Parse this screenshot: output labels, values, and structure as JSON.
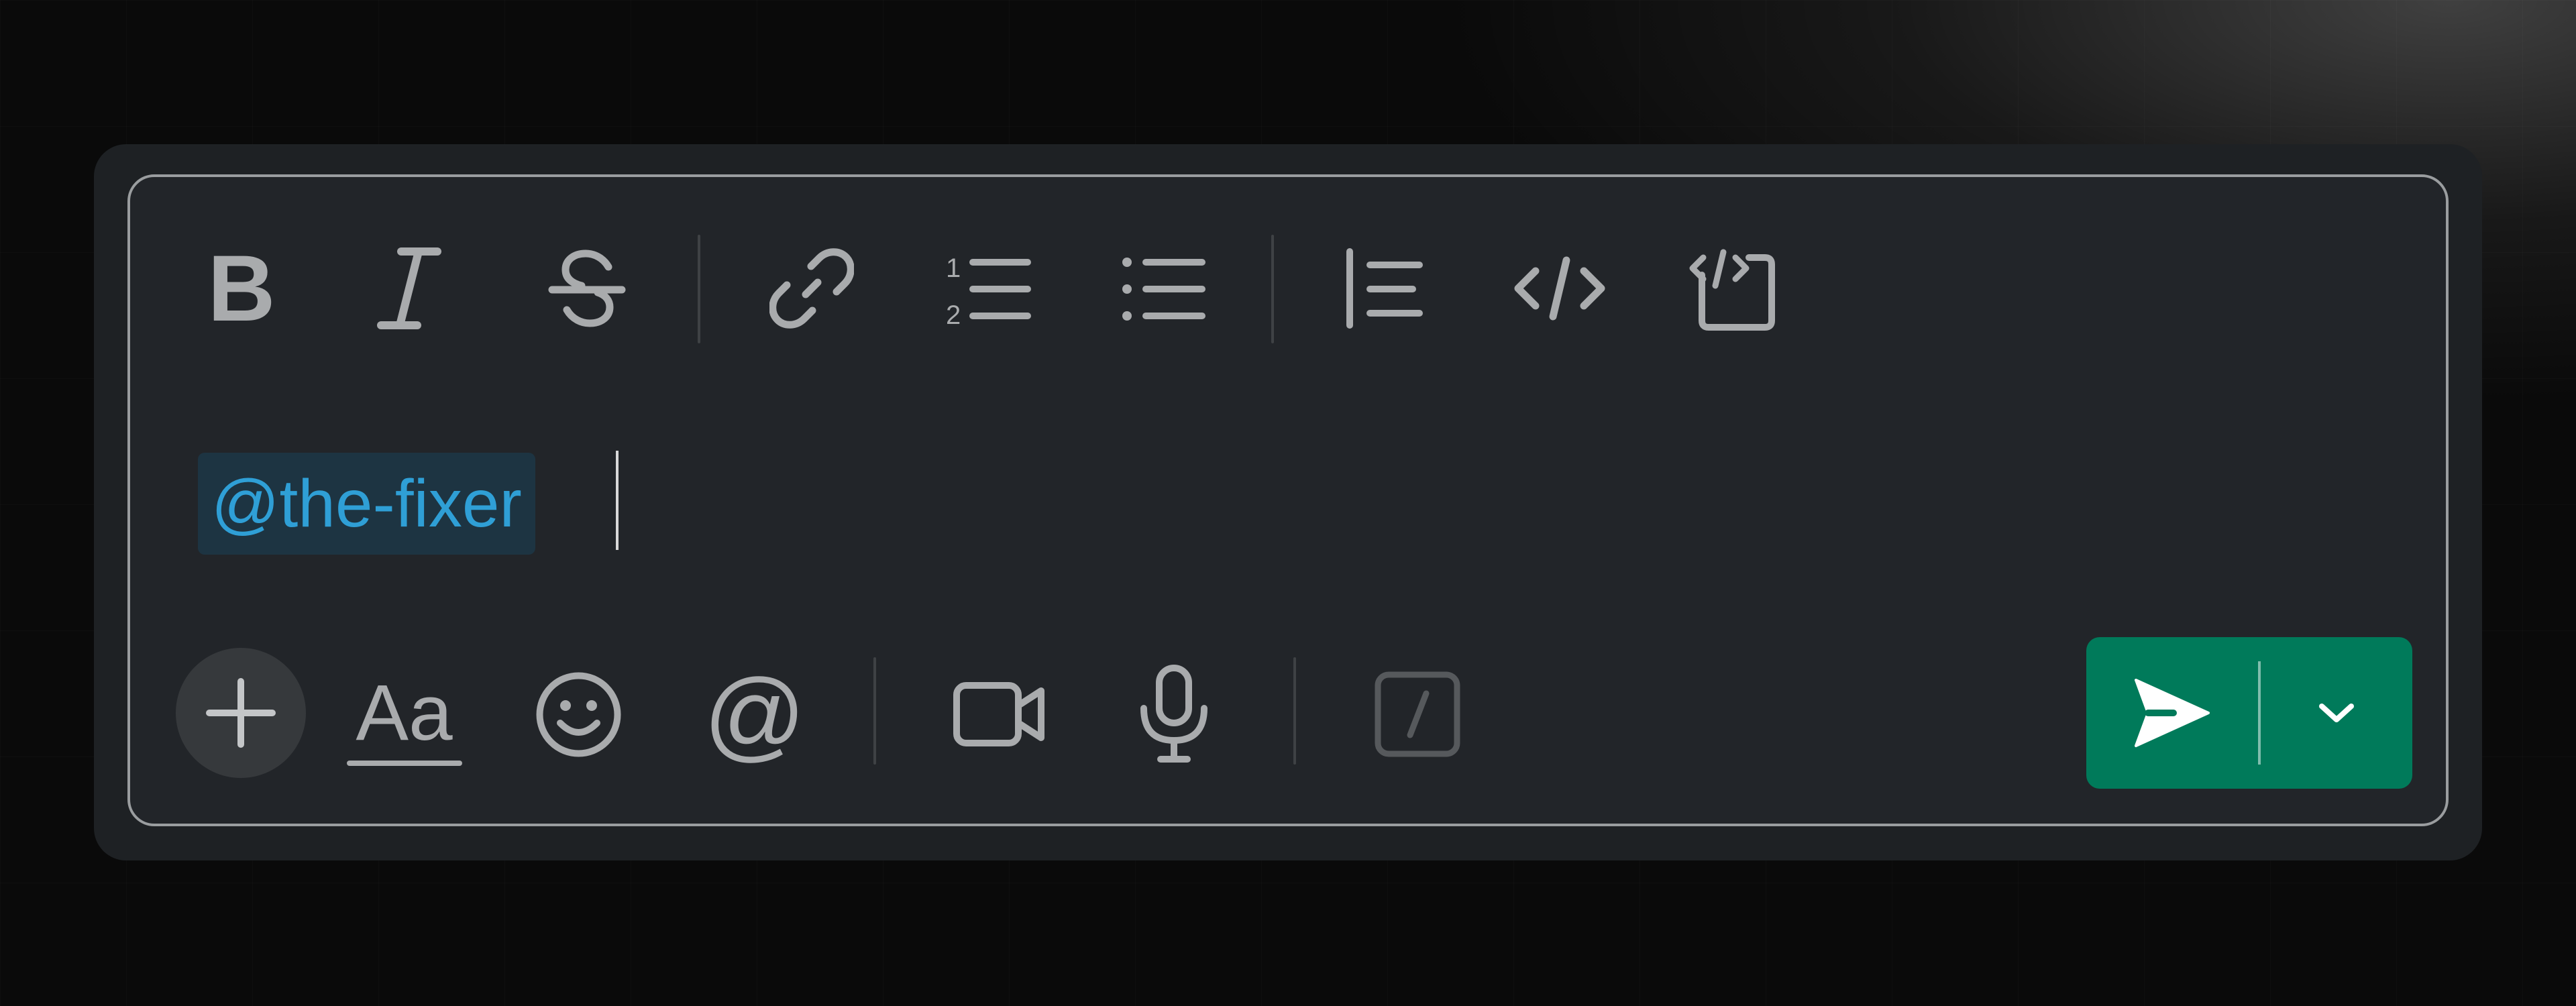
{
  "toolbar": {
    "bold_label": "B",
    "italic_label": "I",
    "strike_label": "S",
    "link_icon": "link-icon",
    "ordered_list_icon": "ordered-list-icon",
    "ordered_list_numbers": [
      "1",
      "2"
    ],
    "bullet_list_icon": "bullet-list-icon",
    "quote_icon": "blockquote-icon",
    "code_icon": "code-icon",
    "code_block_icon": "code-block-icon"
  },
  "message": {
    "mention": "@the-fixer"
  },
  "actions": {
    "attach_icon": "plus-icon",
    "format_label": "Aa",
    "emoji_icon": "smiley-icon",
    "mention_label": "@",
    "video_icon": "video-camera-icon",
    "audio_icon": "microphone-icon",
    "shortcut_label": "/",
    "send_icon": "paper-plane-icon",
    "send_options_icon": "chevron-down-icon"
  },
  "colors": {
    "send_button": "#007a5a",
    "mention_text": "#2f9fd6",
    "mention_background": "#1d3442",
    "icon": "#a9abad"
  }
}
